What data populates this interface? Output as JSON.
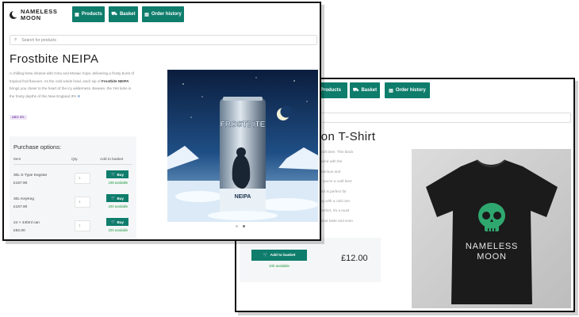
{
  "front_window": {
    "logo": {
      "line1": "NAMELESS",
      "line2": "MOON"
    },
    "nav": {
      "products": "Products",
      "basket": "Basket",
      "order_history": "Order history"
    },
    "search": {
      "placeholder": "Search for products"
    },
    "product": {
      "title": "Frostbite NEIPA",
      "description_before": "A chilling brew infused with Citra and Mosaic hops, delivering a frosty burst of tropical fruit flavours. As the cold winds howl, each sip of ",
      "description_bold": "Frostbite NEIPA",
      "description_after": " brings you closer to the heart of the icy wilderness. Beware, the Yeti lurks in the frosty depths of this New England IPA",
      "abv_badge": "ABV: 5%",
      "can_label_top": "FROSTBITE",
      "can_label_bottom": "NEIPA"
    },
    "purchase": {
      "heading": "Purchase options:",
      "col_item": "Item",
      "col_qty": "Qty.",
      "col_add": "Add to basket",
      "rows": [
        {
          "name": "30L S-Type Kegstar",
          "price": "£157.90",
          "qty": "1",
          "buy": "Buy",
          "available": "198 available"
        },
        {
          "name": "30L KeyKeg",
          "price": "£167.90",
          "qty": "1",
          "buy": "Buy",
          "available": "200 available"
        },
        {
          "name": "24 × 440ml can",
          "price": "£92.00",
          "qty": "1",
          "buy": "Buy",
          "available": "200 available"
        }
      ]
    }
  },
  "back_window": {
    "nav": {
      "products": "Products",
      "basket": "Basket",
      "order_history": "Order history"
    },
    "product": {
      "title": "oon T-Shirt",
      "description_lines": [
        "fo craft beer. This black",
        "c paired with the",
        "mysterious and",
        "ther you're a craft beer",
        "s shirt is perfect for",
        "axing with a cold one.",
        "e comfort, it's a must",
        "to great taste and even"
      ],
      "add_to_basket": "Add to basket",
      "available": "100 available",
      "price": "£12.00",
      "shirt_text_line1": "NAMELESS",
      "shirt_text_line2": "MOON"
    }
  },
  "colors": {
    "accent": "#0f7d6c",
    "available": "#1e9b3d",
    "badge_bg": "#efe6f7",
    "badge_text": "#7b4ea6"
  },
  "icons": [
    "moon-logo-icon",
    "products-icon",
    "basket-icon",
    "order-history-icon",
    "search-icon",
    "cart-icon",
    "sparkle-icon"
  ]
}
